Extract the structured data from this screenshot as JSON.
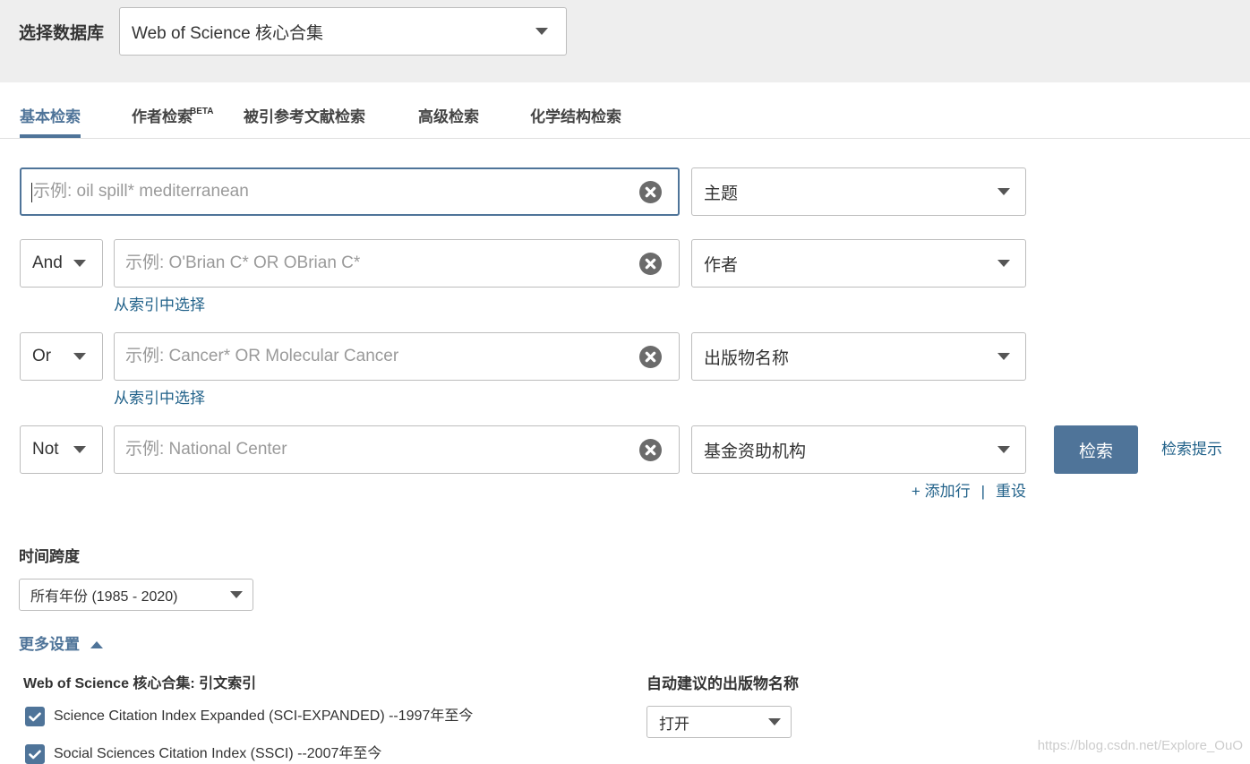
{
  "database": {
    "label": "选择数据库",
    "selected": "Web of Science 核心合集"
  },
  "tabs": [
    {
      "label": "基本检索",
      "active": true
    },
    {
      "label": "作者检索",
      "badge": "BETA",
      "active": false
    },
    {
      "label": "被引参考文献检索",
      "active": false
    },
    {
      "label": "高级检索",
      "active": false
    },
    {
      "label": "化学结构检索",
      "active": false
    }
  ],
  "search_rows": [
    {
      "placeholder": "示例: oil spill* mediterranean",
      "field": "主题",
      "focused": true
    },
    {
      "operator": "And",
      "placeholder": "示例: O'Brian C* OR OBrian C*",
      "field": "作者",
      "index_link": "从索引中选择"
    },
    {
      "operator": "Or",
      "placeholder": "示例: Cancer* OR Molecular Cancer",
      "field": "出版物名称",
      "index_link": "从索引中选择"
    },
    {
      "operator": "Not",
      "placeholder": "示例: National Center",
      "field": "基金资助机构"
    }
  ],
  "actions": {
    "search_button": "检索",
    "search_tips": "检索提示",
    "add_row": "+ 添加行",
    "separator": "|",
    "reset": "重设"
  },
  "timespan": {
    "label": "时间跨度",
    "selected": "所有年份 (1985 - 2020)"
  },
  "more_settings": {
    "label": "更多设置",
    "expanded": true
  },
  "citation_indexes": {
    "heading": "Web of Science 核心合集: 引文索引",
    "items": [
      {
        "label": "Science Citation Index Expanded (SCI-EXPANDED) --1997年至今",
        "checked": true
      },
      {
        "label": "Social Sciences Citation Index (SSCI) --2007年至今",
        "checked": true
      }
    ]
  },
  "autosuggest": {
    "heading": "自动建议的出版物名称",
    "selected": "打开"
  },
  "watermark": "https://blog.csdn.net/Explore_OuO",
  "icons": {
    "dropdown": "caret-down-icon",
    "clear": "clear-icon",
    "collapse": "caret-up-icon",
    "checkbox": "checkmark-icon"
  },
  "colors": {
    "accent": "#4f7499",
    "link": "#22628a",
    "top_band": "#eeeeee",
    "text": "#333333",
    "placeholder": "#9a9a9a",
    "border": "#bdbdbd",
    "clear_icon": "#6b6b6b",
    "watermark": "#cccccc"
  }
}
